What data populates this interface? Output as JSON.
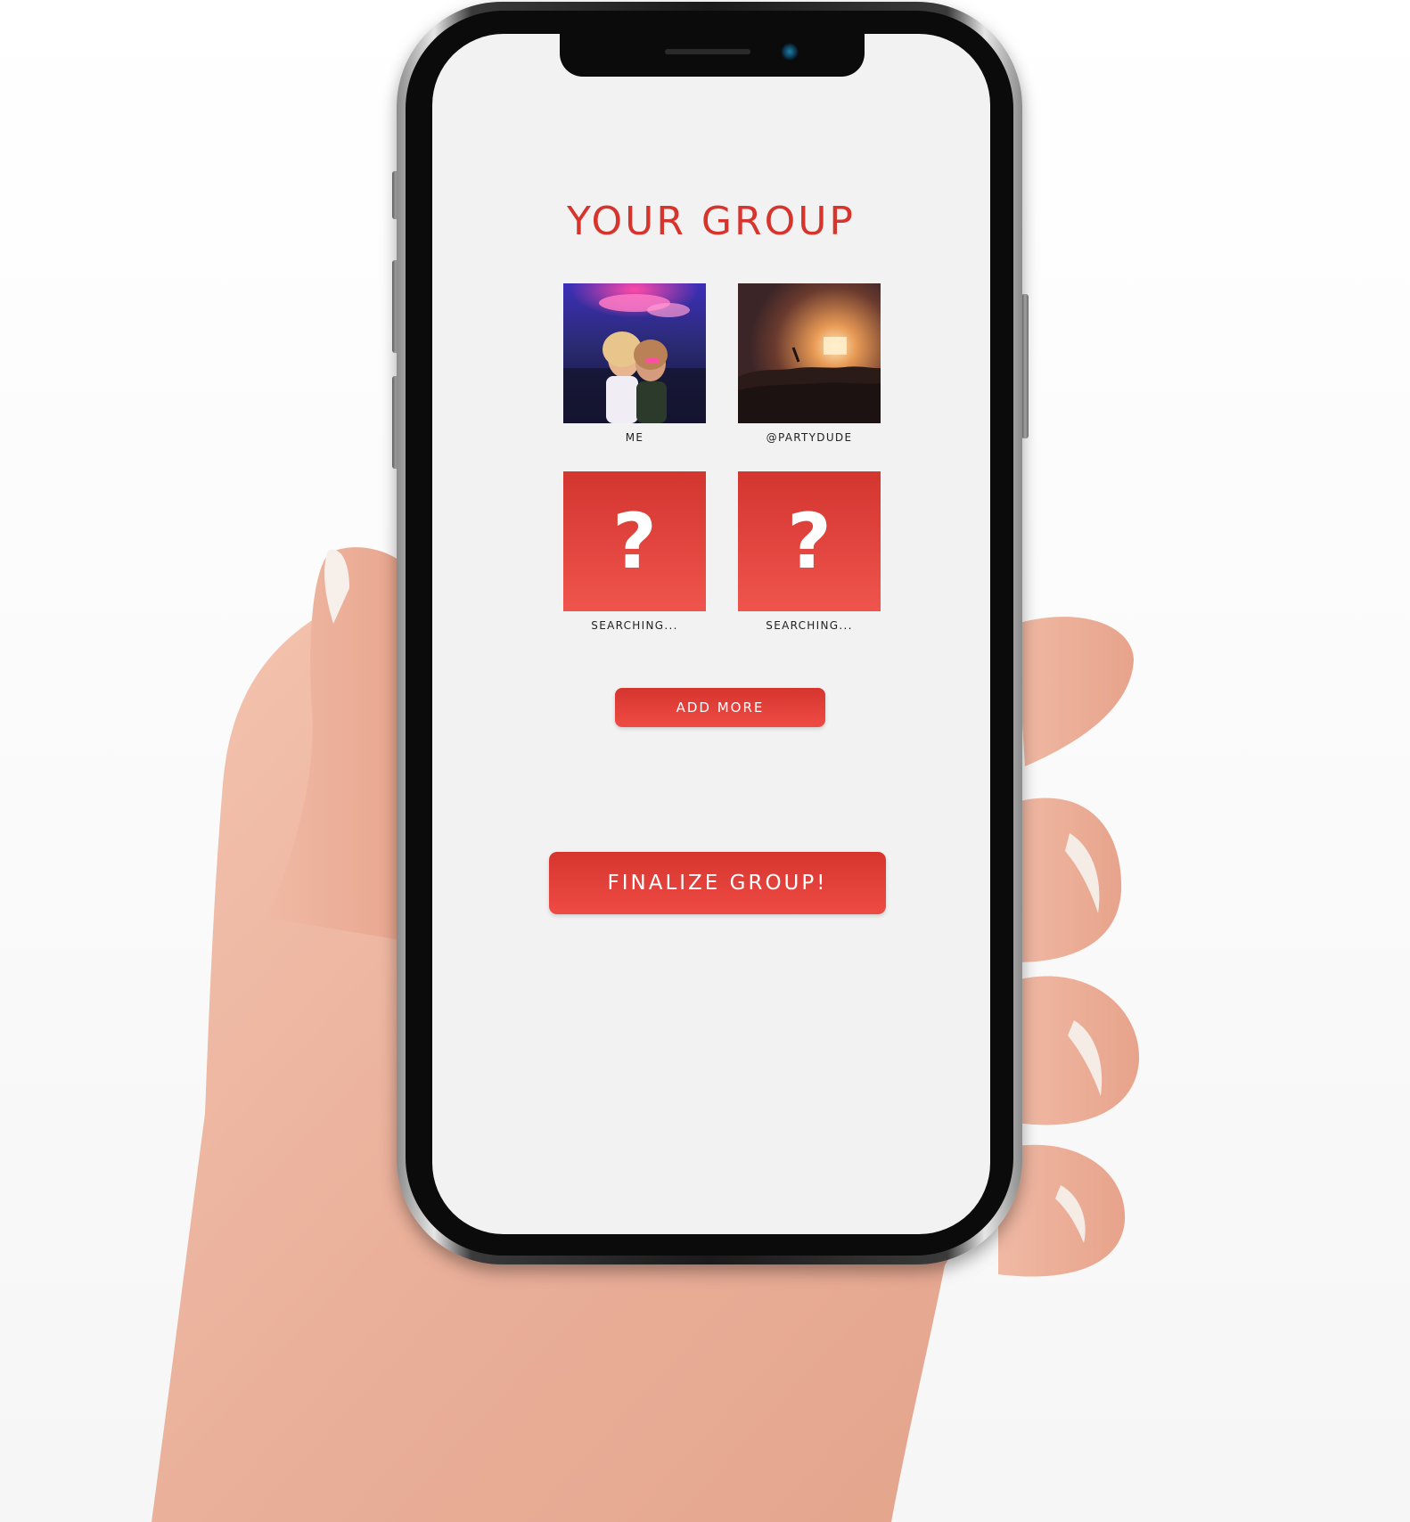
{
  "screen": {
    "title": "YOUR GROUP",
    "members": [
      {
        "caption": "ME",
        "photo": "party-friends-photo"
      },
      {
        "caption": "@PARTYDUDE",
        "photo": "concert-crowd-photo"
      },
      {
        "caption": "SEARCHING...",
        "icon": "question-mark-icon"
      },
      {
        "caption": "SEARCHING...",
        "icon": "question-mark-icon"
      }
    ],
    "add_more_label": "ADD MORE",
    "finalize_label": "FINALIZE GROUP!",
    "question_glyph": "?"
  },
  "colors": {
    "accent": "#d6352e",
    "accent_light": "#ef544d",
    "screen_bg": "#f2f2f2"
  }
}
